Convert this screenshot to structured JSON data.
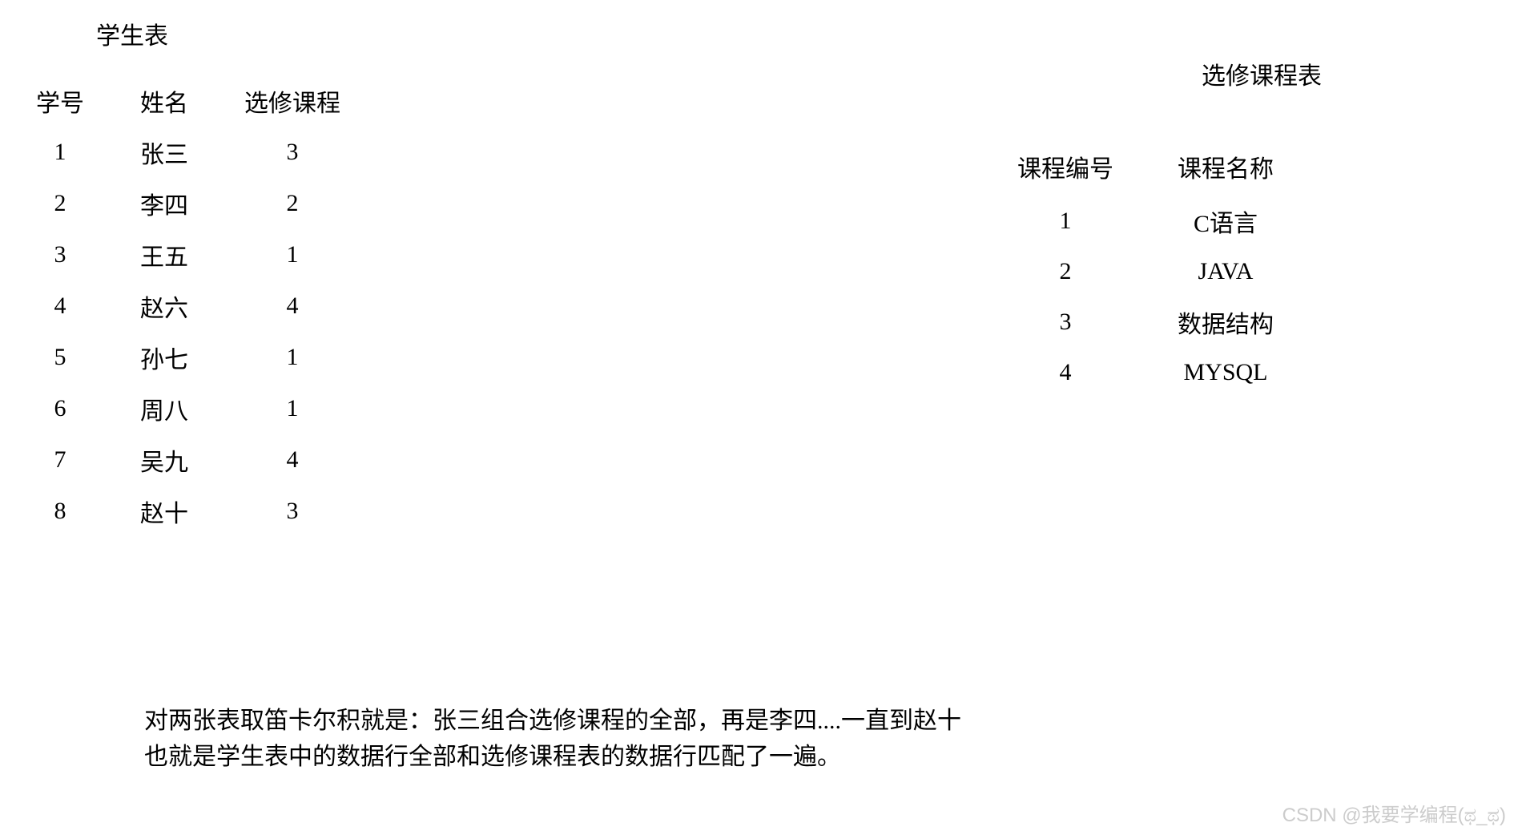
{
  "leftTable": {
    "title": "学生表",
    "headers": {
      "col1": "学号",
      "col2": "姓名",
      "col3": "选修课程"
    },
    "rows": [
      {
        "id": "1",
        "name": "张三",
        "course": "3"
      },
      {
        "id": "2",
        "name": "李四",
        "course": "2"
      },
      {
        "id": "3",
        "name": "王五",
        "course": "1"
      },
      {
        "id": "4",
        "name": "赵六",
        "course": "4"
      },
      {
        "id": "5",
        "name": "孙七",
        "course": "1"
      },
      {
        "id": "6",
        "name": "周八",
        "course": "1"
      },
      {
        "id": "7",
        "name": "吴九",
        "course": "4"
      },
      {
        "id": "8",
        "name": "赵十",
        "course": "3"
      }
    ]
  },
  "rightTable": {
    "title": "选修课程表",
    "headers": {
      "col1": "课程编号",
      "col2": "课程名称"
    },
    "rows": [
      {
        "id": "1",
        "name": "C语言"
      },
      {
        "id": "2",
        "name": "JAVA"
      },
      {
        "id": "3",
        "name": "数据结构"
      },
      {
        "id": "4",
        "name": "MYSQL"
      }
    ]
  },
  "footer": {
    "line1": "对两张表取笛卡尔积就是：张三组合选修课程的全部，再是李四....一直到赵十",
    "line2": "也就是学生表中的数据行全部和选修课程表的数据行匹配了一遍。"
  },
  "watermark": "CSDN @我要学编程(ಥ_ಥ)"
}
